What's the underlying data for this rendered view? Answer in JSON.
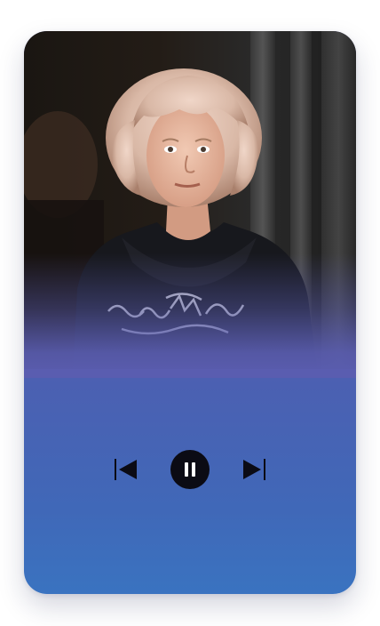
{
  "player": {
    "artwork_icon": "person-in-black-hoodie-photo",
    "state": "playing"
  },
  "controls": {
    "previous": {
      "icon": "skip-previous-icon"
    },
    "play_pause": {
      "icon": "pause-icon"
    },
    "next": {
      "icon": "skip-next-icon"
    }
  },
  "colors": {
    "card_top": "#5a5db0",
    "card_bottom": "#3a73c0",
    "control_color": "#0b0b14",
    "page_background": "#ffffff"
  }
}
